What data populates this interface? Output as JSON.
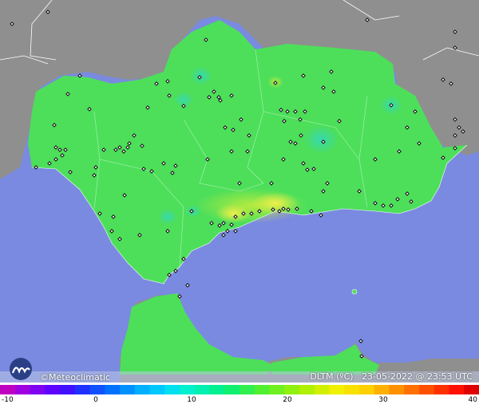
{
  "map": {
    "colors": {
      "land_gray": "#8f8f8f",
      "sea": "#7a8ae0",
      "region": "#4ddf5a",
      "warm": "#c8ec3a",
      "hot": "#ecef3a",
      "cool": "#3ddf9a",
      "border": "#ffffff",
      "station": "#111111"
    },
    "stations_visible": true
  },
  "footer": {
    "brand_symbol": "©",
    "brand_name": "Meteoclimatic",
    "variable": "DLTM (ºC)",
    "datetime": "23-05-2022 @ 23:53 UTC"
  },
  "scale": {
    "ticks": [
      "-10",
      "0",
      "10",
      "20",
      "30",
      "40"
    ],
    "min": -10,
    "max": 40,
    "colors": [
      "#c000c0",
      "#a000e0",
      "#8000f0",
      "#6000ff",
      "#4010ff",
      "#2030ff",
      "#1050ff",
      "#0070ff",
      "#0090ff",
      "#00b0ff",
      "#00c8ff",
      "#00e0f0",
      "#00f0d0",
      "#00f0b0",
      "#00f090",
      "#10f070",
      "#30f050",
      "#50f030",
      "#70f020",
      "#90f010",
      "#b0f000",
      "#d0f000",
      "#f0f000",
      "#f8e000",
      "#ffd000",
      "#ffb000",
      "#ff9000",
      "#ff7000",
      "#ff5000",
      "#ff3000",
      "#ff1000",
      "#e00000"
    ]
  }
}
